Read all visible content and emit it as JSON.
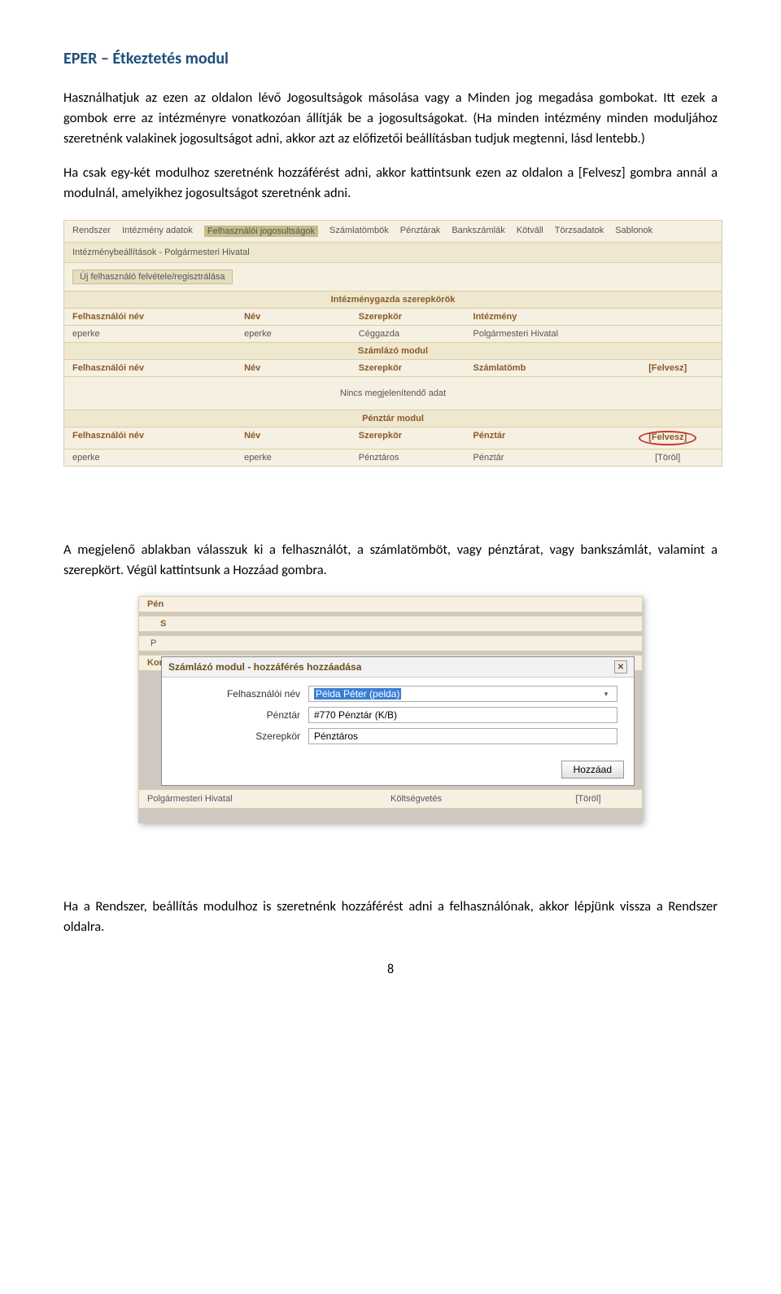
{
  "header": "EPER – Étkeztetés modul",
  "p1": "Használhatjuk az ezen az oldalon lévő Jogosultságok másolása vagy a Minden jog megadása gombokat. Itt ezek a gombok erre az intézményre vonatkozóan állítják be a jogosultságokat. (Ha minden intézmény minden moduljához szeretnénk valakinek jogosultságot adni, akkor azt az előfizetői beállításban tudjuk megtenni, lásd lentebb.)",
  "p2": "Ha csak egy-két modulhoz szeretnénk hozzáférést adni, akkor kattintsunk ezen az oldalon a [Felvesz] gombra annál a modulnál, amelyikhez jogosultságot szeretnénk adni.",
  "p3": "A megjelenő ablakban válasszuk ki a felhasználót, a számlatömböt, vagy pénztárat, vagy bankszámlát, valamint a szerepkört. Végül kattintsunk a Hozzáad gombra.",
  "p4": "Ha a Rendszer, beállítás modulhoz is szeretnénk hozzáférést adni a felhasználónak, akkor lépjünk vissza a Rendszer oldalra.",
  "shotA": {
    "tabs": [
      "Rendszer",
      "Intézmény adatok",
      "Felhasználói jogosultságok",
      "Számlatömbök",
      "Pénztárak",
      "Bankszámlák",
      "Kötváll",
      "Törzsadatok",
      "Sablonok"
    ],
    "breadcrumb": "Intézménybeállítások - Polgármesteri Hivatal",
    "regButton": "Új felhasználó felvétele/regisztrálása",
    "sec1": {
      "title": "Intézménygazda szerepkörök",
      "cols": [
        "Felhasználói név",
        "Név",
        "Szerepkör",
        "Intézmény"
      ],
      "row": [
        "eperke",
        "eperke",
        "Céggazda",
        "Polgármesteri Hivatal"
      ]
    },
    "sec2": {
      "title": "Számlázó modul",
      "cols": [
        "Felhasználói név",
        "Név",
        "Szerepkör",
        "Számlatömb",
        "[Felvesz]"
      ],
      "nodata": "Nincs megjelenítendő adat"
    },
    "sec3": {
      "title": "Pénztár modul",
      "cols": [
        "Felhasználói név",
        "Név",
        "Szerepkör",
        "Pénztár",
        "[Felvesz]"
      ],
      "row": [
        "eperke",
        "eperke",
        "Pénztáros",
        "Pénztár",
        "[Töröl]"
      ]
    }
  },
  "shotB": {
    "bgLabels": [
      "Pén",
      "S",
      "P",
      "Kor"
    ],
    "dialogTitle": "Számlázó modul - hozzáférés hozzáadása",
    "fields": {
      "f1l": "Felhasználói név",
      "f1v": "Példa Péter (pelda)",
      "f2l": "Pénztár",
      "f2v": "#770 Pénztár (K/B)",
      "f3l": "Szerepkör",
      "f3v": "Pénztáros"
    },
    "addBtn": "Hozzáad",
    "bottomRow": [
      "Polgármesteri Hivatal",
      "Költségvetés",
      "[Töröl]"
    ]
  },
  "pageNum": "8"
}
